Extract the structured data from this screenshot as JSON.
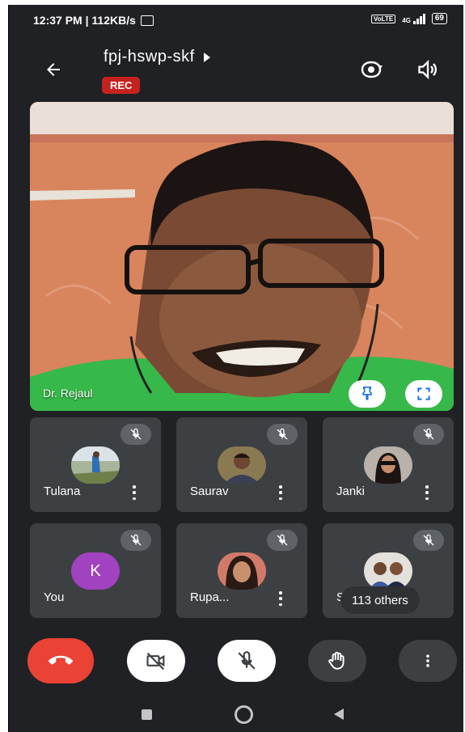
{
  "status_bar": {
    "time_speed": "12:37 PM | 112KB/s",
    "network": "4G",
    "battery": "69"
  },
  "header": {
    "meeting_code": "fpj-hswp-skf",
    "recording_badge": "REC"
  },
  "main_video": {
    "participant_name": "Dr. Rejaul"
  },
  "participants": [
    {
      "name": "Tulana",
      "muted": true
    },
    {
      "name": "Saurav",
      "muted": true
    },
    {
      "name": "Janki",
      "muted": true
    },
    {
      "name": "You",
      "avatar_letter": "K",
      "muted": true
    },
    {
      "name": "Rupa...",
      "muted": true
    },
    {
      "name": "Su...",
      "muted": true
    }
  ],
  "others_chip": "113 others",
  "colors": {
    "background": "#202124",
    "tile": "#3c4043",
    "rec_red": "#c5221f",
    "end_call_red": "#ea4335",
    "you_avatar": "#a142c0"
  },
  "icons": {
    "back": "arrow-left-icon",
    "title_dropdown": "caret-right-icon",
    "switch_camera": "switch-camera-icon",
    "audio": "speaker-icon",
    "pin": "pin-icon",
    "fullscreen": "fullscreen-icon",
    "muted": "mic-off-icon",
    "end_call": "phone-hangup-icon",
    "video_off": "video-off-icon",
    "mic_off": "mic-off-icon",
    "raise_hand": "hand-icon",
    "more": "more-vert-icon"
  }
}
